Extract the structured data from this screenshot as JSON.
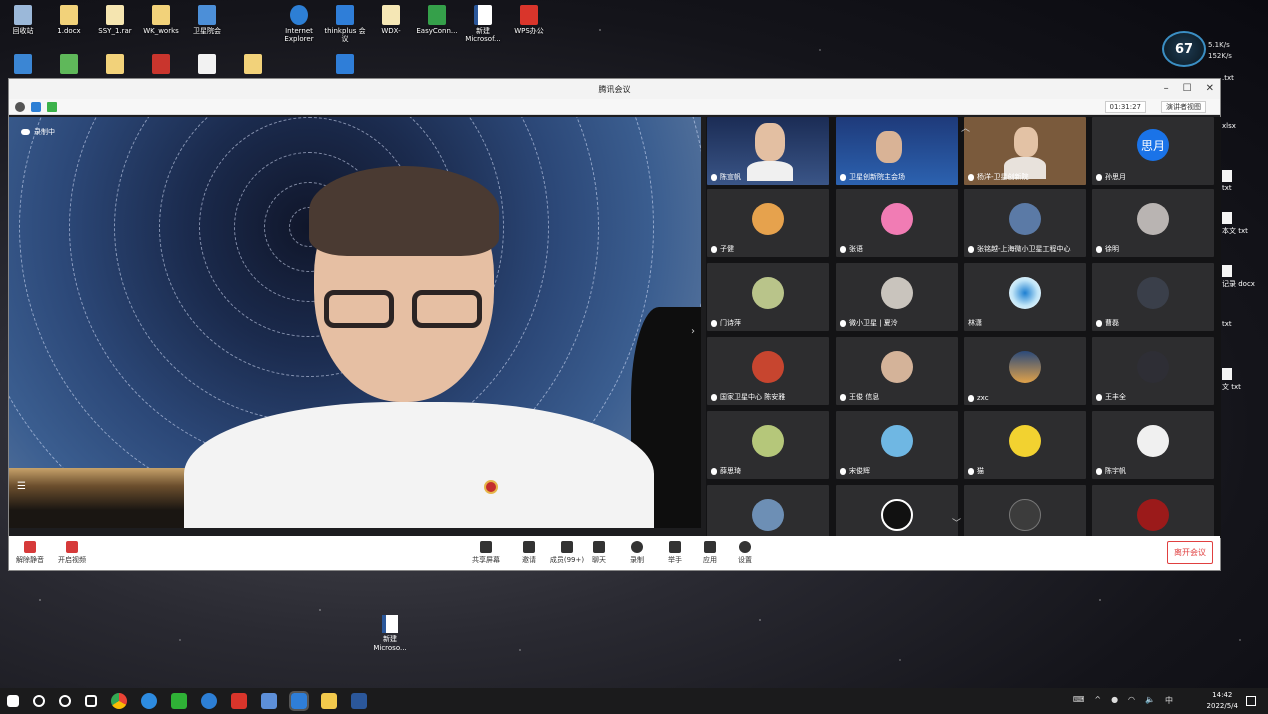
{
  "window": {
    "title": "腾讯会议",
    "timer": "01:31:27",
    "view_mode": "演讲者视图"
  },
  "main": {
    "recording": "录制中"
  },
  "participants_avatar_text": "思月",
  "participants": [
    "陈宣帆",
    "卫星创新院主会场",
    "杨洋-卫星创新院",
    "孙思月",
    "子健",
    "张语",
    "张铭越-上海微小卫星工程中心",
    "徐明",
    "门诗萍",
    "微小卫星 | 夏泠",
    "林潇",
    "曹磊",
    "国家卫星中心 陈安雅",
    "王俊 信息",
    "zxc",
    "王丰全",
    "薛思琦",
    "宋俊辉",
    "猫",
    "陈宇帆"
  ],
  "toolbar": {
    "mute": "解除静音",
    "video": "开启视频",
    "share": "共享屏幕",
    "invite": "邀请",
    "members": "成员(99+)",
    "chat": "聊天",
    "record": "录制",
    "raise_hand": "举手",
    "apps": "应用",
    "settings": "设置",
    "leave": "离开会议"
  },
  "desktop": {
    "icons": [
      "回收站",
      "1.docx",
      "SSY_1.rar",
      "WK_works",
      "卫星院会",
      "Internet Explorer",
      "thinkplus 会议",
      "WDX-",
      "EasyConn...",
      "新建 Microsof...",
      "WPS办公"
    ],
    "side_files": [
      ".txt",
      "xlsx",
      "txt",
      "本文 txt",
      "记录 docx",
      "txt",
      "文 txt"
    ],
    "new_doc": "新建 Microso..."
  },
  "widget": {
    "percent": "67",
    "up": "5.1K/s",
    "down": "152K/s"
  },
  "taskbar": {
    "ime": "中",
    "time": "14:42",
    "date": "2022/5/4"
  }
}
